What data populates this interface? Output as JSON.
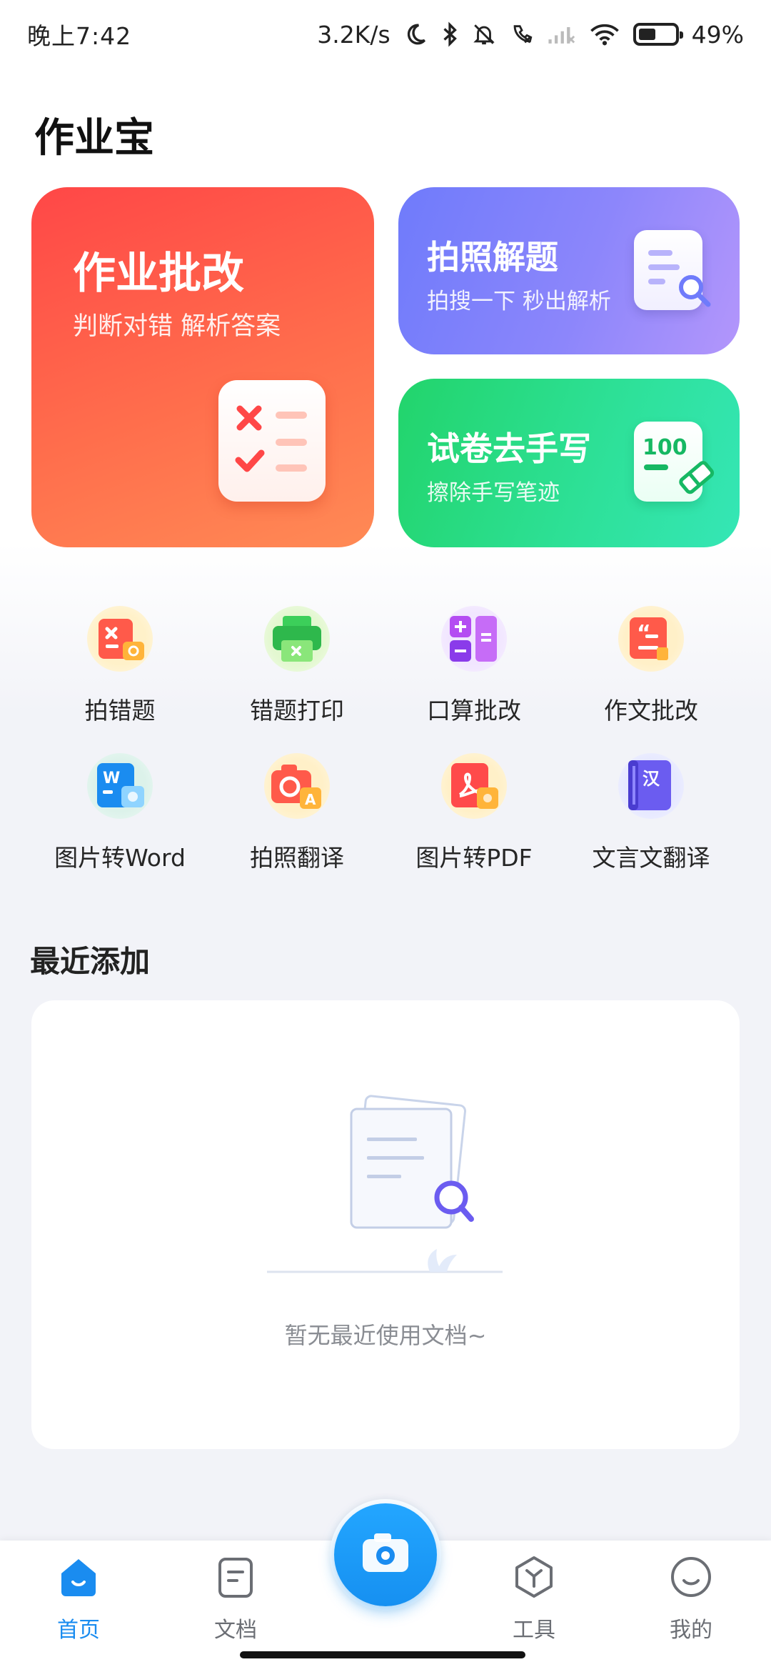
{
  "status_bar": {
    "time": "晚上7:42",
    "network_speed": "3.2K/s",
    "battery": "49%",
    "battery_level": 0.49
  },
  "app_title": "作业宝",
  "cards": {
    "homework_correction": {
      "title": "作业批改",
      "subtitle": "判断对错 解析答案"
    },
    "photo_solve": {
      "title": "拍照解题",
      "subtitle": "拍搜一下 秒出解析"
    },
    "paper_handwriting": {
      "title": "试卷去手写",
      "subtitle": "擦除手写笔迹",
      "badge": "100"
    }
  },
  "tools": [
    {
      "label": "拍错题",
      "icon": "wrong-question-camera-icon"
    },
    {
      "label": "错题打印",
      "icon": "printer-icon"
    },
    {
      "label": "口算批改",
      "icon": "calculator-icon"
    },
    {
      "label": "作文批改",
      "icon": "essay-quote-icon"
    },
    {
      "label": "图片转Word",
      "icon": "word-icon"
    },
    {
      "label": "拍照翻译",
      "icon": "camera-translate-icon"
    },
    {
      "label": "图片转PDF",
      "icon": "pdf-icon"
    },
    {
      "label": "文言文翻译",
      "icon": "classical-chinese-book-icon"
    }
  ],
  "tool_glyphs": {
    "word": "W",
    "translate": "A",
    "classical": "汉"
  },
  "recent": {
    "title": "最近添加",
    "empty_text": "暂无最近使用文档~"
  },
  "tabbar": {
    "home": "首页",
    "docs": "文档",
    "tools": "工具",
    "mine": "我的"
  },
  "colors": {
    "accent": "#1a8cf0",
    "red_card": "#ff5a4a",
    "purple_card": "#8c86fb",
    "green_card": "#2ee19a"
  }
}
